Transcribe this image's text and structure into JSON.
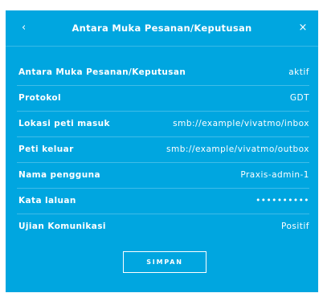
{
  "theme": {
    "accent": "#00a6e0",
    "text": "#ffffff"
  },
  "header": {
    "title": "Antara Muka Pesanan/Keputusan",
    "back_icon": "‹",
    "close_icon": "×"
  },
  "settings": {
    "rows": [
      {
        "label": "Antara Muka Pesanan/Keputusan",
        "value": "aktif"
      },
      {
        "label": "Protokol",
        "value": "GDT"
      },
      {
        "label": "Lokasi peti masuk",
        "value": "smb://example/vivatmo/inbox"
      },
      {
        "label": "Peti keluar",
        "value": "smb://example/vivatmo/outbox"
      },
      {
        "label": "Nama pengguna",
        "value": "Praxis-admin-1"
      },
      {
        "label": "Kata laluan",
        "value": "••••••••••"
      },
      {
        "label": "Ujian Komunikasi",
        "value": "Positif"
      }
    ]
  },
  "footer": {
    "save_label": "SIMPAN"
  }
}
